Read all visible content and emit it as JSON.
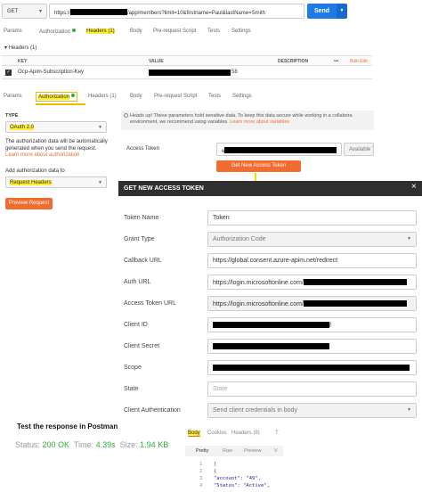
{
  "request": {
    "method": "GET",
    "url_prefix": "https://",
    "url_suffix": "/app/members?limit=10&firstname=Paul&lastName=Smith",
    "send_label": "Send"
  },
  "top_tabs": {
    "params": "Params",
    "authorization": "Authorization",
    "headers": "Headers (1)",
    "body": "Body",
    "prerequest": "Pre-request Script",
    "tests": "Tests",
    "settings": "Settings"
  },
  "headers_section": {
    "title": "Headers (1)",
    "col_key": "KEY",
    "col_value": "VALUE",
    "col_description": "DESCRIPTION",
    "more": "•••",
    "bulk_edit": "Bulk Edit",
    "row_key": "Ocp-Apim-Subscription-Key",
    "row_value_suffix": "58"
  },
  "mid_tabs": {
    "params": "Params",
    "authorization": "Authorization",
    "headers": "Headers (1)",
    "body": "Body",
    "prerequest": "Pre-request Script",
    "tests": "Tests",
    "settings": "Settings"
  },
  "auth_panel": {
    "type_label": "TYPE",
    "type_value": "OAuth 2.0",
    "info_text_1": "The authorization data will be automatically",
    "info_text_2": "generated when you send the request.",
    "learn_more": "Learn more about authorization",
    "add_to_label": "Add authorization data to",
    "add_to_value": "Request Headers",
    "preview_button": "Preview Request"
  },
  "notice": {
    "line1": "Heads up! These parameters hold sensitive data. To keep this data secure while working in a collabora",
    "line2": "environment, we recommend using variables.",
    "link": "Learn more about variables"
  },
  "access_token": {
    "label": "Access Token",
    "prefix": "e",
    "available_label": "Available T",
    "get_new_button": "Get New Access Token"
  },
  "modal": {
    "title": "GET NEW ACCESS TOKEN",
    "close": "×",
    "fields": {
      "token_name": {
        "label": "Token Name",
        "value": "Token"
      },
      "grant_type": {
        "label": "Grant Type",
        "value": "Authorization Code"
      },
      "callback_url": {
        "label": "Callback URL",
        "value": "https://global.consent.azure-apim.net/redirect"
      },
      "auth_url": {
        "label": "Auth URL",
        "value": "https://login.microsoftonline.com/"
      },
      "access_token_url": {
        "label": "Access Token URL",
        "value": "https://login.microsoftonline.com/"
      },
      "client_id": {
        "label": "Client ID",
        "value": "f"
      },
      "client_secret": {
        "label": "Client Secret",
        "value": ""
      },
      "scope": {
        "label": "Scope",
        "value": ""
      },
      "state": {
        "label": "State",
        "placeholder": "State"
      },
      "client_authentication": {
        "label": "Client Authentication",
        "value": "Send client credentials in body"
      }
    }
  },
  "test_response": {
    "title": "Test the response in Postman",
    "status_label": "Status:",
    "status_value": "200 OK",
    "time_label": "Time:",
    "time_value": "4.39s",
    "size_label": "Size:",
    "size_value": "1.94 KB",
    "tabs": {
      "body": "Body",
      "cookies": "Cookies",
      "headers": "Headers (8)",
      "test": "T"
    },
    "view_tabs": {
      "pretty": "Pretty",
      "raw": "Raw",
      "preview": "Preview",
      "v": "V"
    },
    "code_lines": [
      {
        "n": "1",
        "text": "["
      },
      {
        "n": "2",
        "text": "  {"
      },
      {
        "n": "3",
        "text": "    \"account\": \"49\","
      },
      {
        "n": "4",
        "text": "    \"Status\": \"Active\","
      }
    ]
  },
  "colors": {
    "accent_orange": "#f26b2f",
    "send_blue": "#1e7ae6",
    "highlight_yellow": "#ffee33",
    "modal_header": "#2f2f2f",
    "status_green": "#33aa33"
  }
}
